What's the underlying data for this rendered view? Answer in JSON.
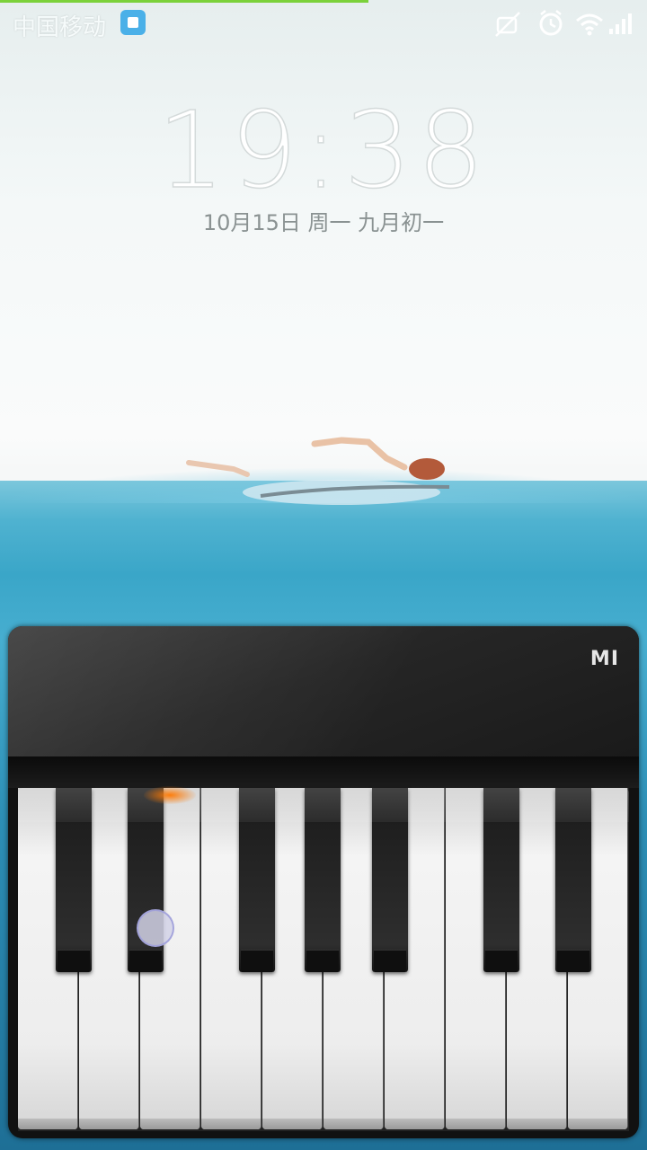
{
  "status_bar": {
    "carrier": "中国移动",
    "notification_icon": "app-notification-icon",
    "icons": [
      "mute-icon",
      "alarm-clock-icon",
      "wifi-icon",
      "signal-strength-icon"
    ]
  },
  "lockscreen": {
    "time": "19:38",
    "date": "10月15日 周一 九月初一"
  },
  "unlock_piano": {
    "brand": "MI",
    "white_keys": 10,
    "black_keys": 7,
    "colors": {
      "body": "#1f1f1f",
      "key_glow": "#ff7a00",
      "touch": "#d2d2e6"
    }
  },
  "colors": {
    "progress_strip": "#7bd13a",
    "sea": "#3aa6c8"
  }
}
